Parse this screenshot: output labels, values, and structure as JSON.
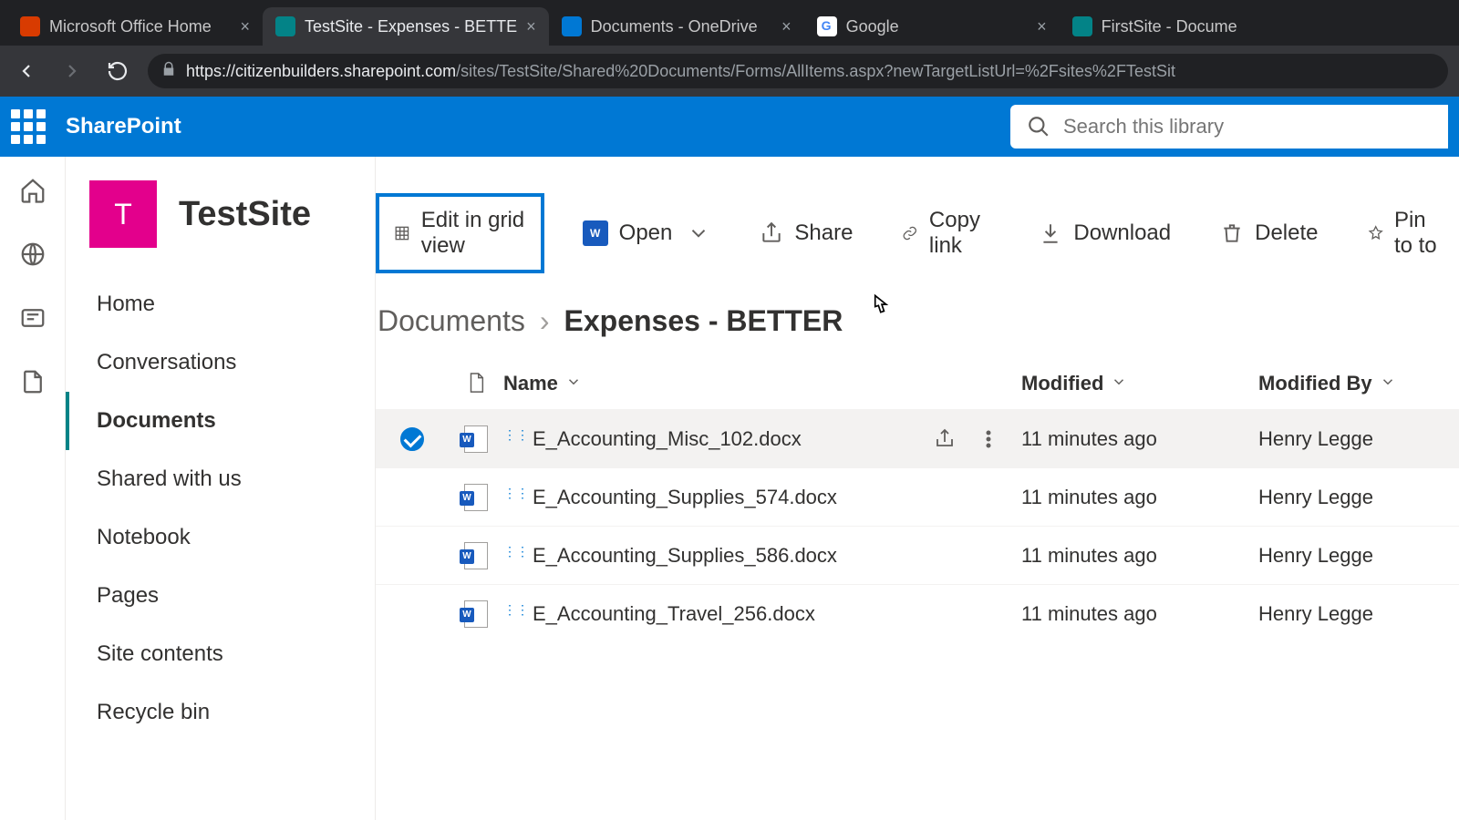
{
  "browser": {
    "tabs": [
      {
        "title": "Microsoft Office Home"
      },
      {
        "title": "TestSite - Expenses - BETTE"
      },
      {
        "title": "Documents - OneDrive"
      },
      {
        "title": "Google"
      },
      {
        "title": "FirstSite - Docume"
      }
    ],
    "url_host": "https://citizenbuilders.sharepoint.com",
    "url_path": "/sites/TestSite/Shared%20Documents/Forms/AllItems.aspx?newTargetListUrl=%2Fsites%2FTestSit"
  },
  "suite": {
    "brand": "SharePoint",
    "search_placeholder": "Search this library"
  },
  "site": {
    "logo_letter": "T",
    "name": "TestSite"
  },
  "nav": {
    "items": [
      "Home",
      "Conversations",
      "Documents",
      "Shared with us",
      "Notebook",
      "Pages",
      "Site contents",
      "Recycle bin"
    ]
  },
  "commands": {
    "edit_grid": "Edit in grid view",
    "open": "Open",
    "share": "Share",
    "copy_link": "Copy link",
    "download": "Download",
    "delete": "Delete",
    "pin": "Pin to to"
  },
  "breadcrumb": {
    "root": "Documents",
    "current": "Expenses - BETTER"
  },
  "columns": {
    "name": "Name",
    "modified": "Modified",
    "modified_by": "Modified By"
  },
  "rows": [
    {
      "name": "E_Accounting_Misc_102.docx",
      "modified": "11 minutes ago",
      "by": "Henry Legge",
      "selected": true
    },
    {
      "name": "E_Accounting_Supplies_574.docx",
      "modified": "11 minutes ago",
      "by": "Henry Legge",
      "selected": false
    },
    {
      "name": "E_Accounting_Supplies_586.docx",
      "modified": "11 minutes ago",
      "by": "Henry Legge",
      "selected": false
    },
    {
      "name": "E_Accounting_Travel_256.docx",
      "modified": "11 minutes ago",
      "by": "Henry Legge",
      "selected": false
    }
  ]
}
